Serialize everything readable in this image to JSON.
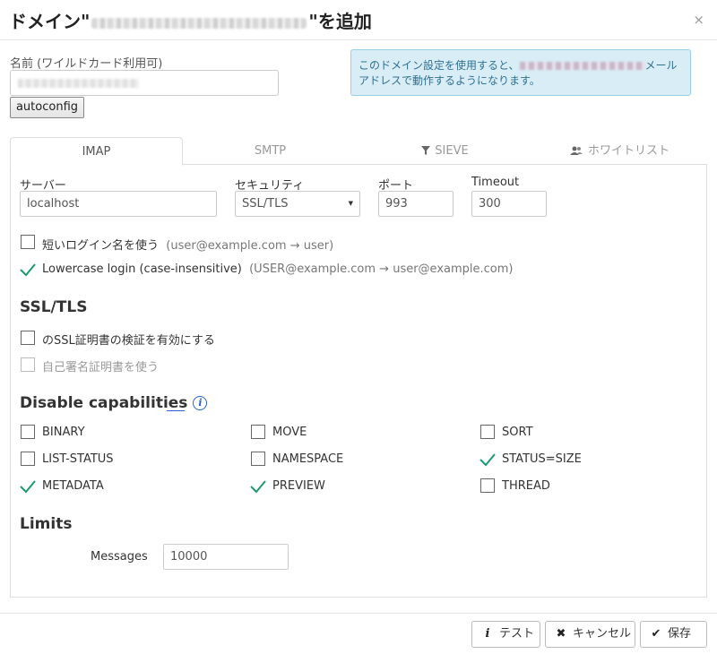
{
  "dialog": {
    "title_prefix": "ドメイン\"",
    "title_suffix": "\"を追加",
    "close_symbol": "×"
  },
  "name": {
    "label": "名前 (ワイルドカード利用可)",
    "autoconfig_label": "autoconfig"
  },
  "info": {
    "text_before": "このドメイン設定を使用すると、",
    "text_after": "メールアドレスで動作するようになります。"
  },
  "tabs": [
    {
      "label": "IMAP",
      "icon": "",
      "active": true
    },
    {
      "label": "SMTP",
      "icon": "",
      "active": false
    },
    {
      "label": "SIEVE",
      "icon": "filter-icon",
      "active": false
    },
    {
      "label": "ホワイトリスト",
      "icon": "users-icon",
      "active": false
    }
  ],
  "imap": {
    "server_label": "サーバー",
    "server_value": "localhost",
    "security_label": "セキュリティ",
    "security_value": "SSL/TLS",
    "port_label": "ポート",
    "port_value": "993",
    "timeout_label": "Timeout",
    "timeout_value": "300",
    "short_login": {
      "label": "短いログイン名を使う",
      "hint": "(user@example.com → user)",
      "checked": false
    },
    "lowercase_login": {
      "label": "Lowercase login (case-insensitive)",
      "hint": "(USER@example.com → user@example.com)",
      "checked": true
    }
  },
  "ssl": {
    "title": "SSL/TLS",
    "verify_cert": {
      "label": "のSSL証明書の検証を有効にする",
      "checked": false
    },
    "self_signed": {
      "label": "自己署名証明書を使う",
      "checked": false,
      "disabled": true
    }
  },
  "capabilities": {
    "title": "Disable capabilities",
    "info_icon": "i",
    "items": [
      {
        "label": "BINARY",
        "checked": false
      },
      {
        "label": "MOVE",
        "checked": false
      },
      {
        "label": "SORT",
        "checked": false
      },
      {
        "label": "LIST-STATUS",
        "checked": false
      },
      {
        "label": "NAMESPACE",
        "checked": false
      },
      {
        "label": "STATUS=SIZE",
        "checked": true
      },
      {
        "label": "METADATA",
        "checked": true
      },
      {
        "label": "PREVIEW",
        "checked": true
      },
      {
        "label": "THREAD",
        "checked": false
      }
    ]
  },
  "limits": {
    "title": "Limits",
    "messages_label": "Messages",
    "messages_value": "10000"
  },
  "footer": {
    "test_label": "テスト",
    "cancel_label": "キャンセル",
    "save_label": "保存"
  },
  "colors": {
    "check": "#1a9b6c",
    "info_bg": "#d9edf7",
    "info_text": "#31708f",
    "link": "#2a5fd6"
  }
}
